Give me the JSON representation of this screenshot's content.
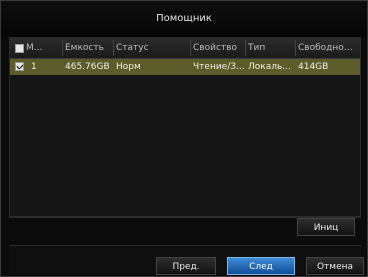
{
  "window": {
    "title": "Помощник"
  },
  "table": {
    "columns": [
      "М...",
      "Емкость",
      "Статус",
      "Свойство",
      "Тип",
      "Свободное ..."
    ],
    "rows": [
      {
        "checked": true,
        "num": "1",
        "capacity": "465.76GB",
        "status": "Норм",
        "property": "Чтение/З...",
        "type": "Локаль...",
        "free": "414GB"
      }
    ]
  },
  "buttons": {
    "init": "Иниц",
    "prev": "Пред.",
    "next": "След",
    "cancel": "Отмена"
  },
  "colors": {
    "selected_row": "#5c5c2a",
    "primary_button": "#2b6fbf"
  }
}
